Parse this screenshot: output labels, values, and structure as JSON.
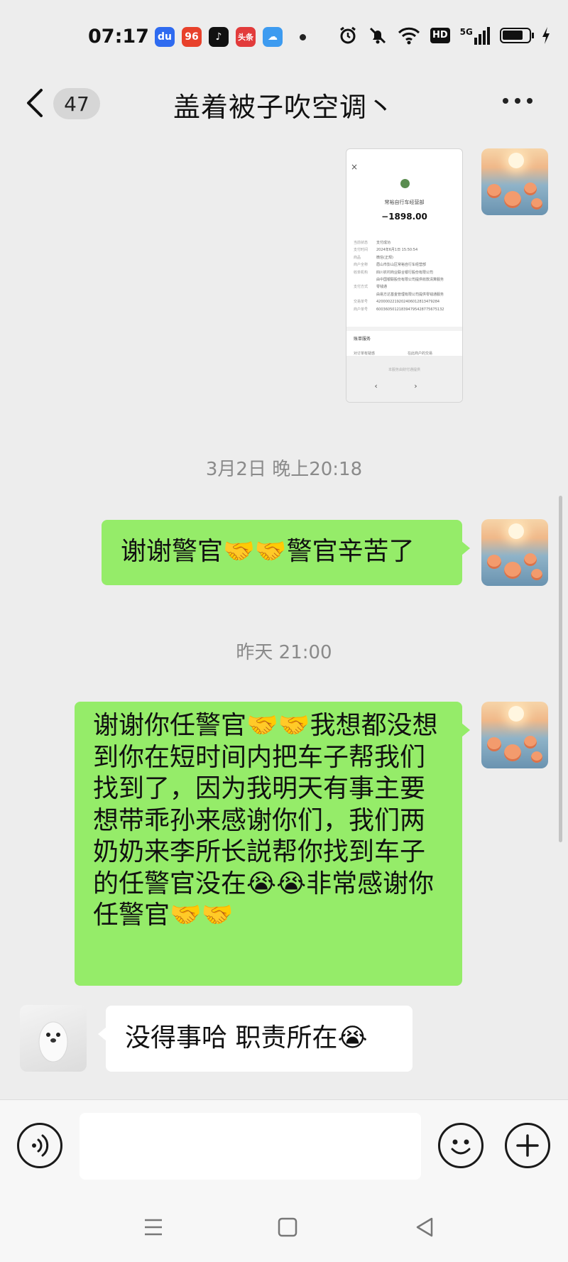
{
  "status_bar": {
    "time": "07:17",
    "apps": [
      {
        "icon": "baidu-icon",
        "label": "du",
        "color": "#2f6bf0"
      },
      {
        "icon": "app-icon",
        "label": "96",
        "color": "#e8412b"
      },
      {
        "icon": "tiktok-icon",
        "label": "♪",
        "color": "#111111"
      },
      {
        "icon": "toutiao-icon",
        "label": "头条",
        "color": "#e23b3b"
      },
      {
        "icon": "weather-icon",
        "label": "☁",
        "color": "#3d9bf0"
      }
    ],
    "indicators": [
      "alarm-icon",
      "mute-icon",
      "wifi-icon",
      "hd-icon",
      "5g-signal-icon",
      "battery-icon",
      "charging-icon"
    ],
    "hd_label": "HD",
    "network_label": "5G"
  },
  "header": {
    "unread_count": "47",
    "title": "盖着被子吹空调丶"
  },
  "messages": {
    "image": {
      "close": "×",
      "shop": "常裕自行车经营部",
      "amount": "−1898.00",
      "rows": [
        {
          "k": "当前状态",
          "v": "支付成功"
        },
        {
          "k": "支付时间",
          "v": "2024年6月1日 15:50:54"
        },
        {
          "k": "商品",
          "v": "微信(正规)"
        },
        {
          "k": "商户全称",
          "v": "眉山市彭山区常裕自行车经营部"
        },
        {
          "k": "收单机构",
          "v": "四川农村商业联合银行股份有限公司"
        },
        {
          "k": "",
          "v": "由中国银联股份有限公司提供收款清算服务"
        },
        {
          "k": "支付方式",
          "v": "零钱通"
        },
        {
          "k": "",
          "v": "由易方达基金管理有限公司提供零钱通服务"
        },
        {
          "k": "交易单号",
          "v": "4200002219202406012813479284"
        },
        {
          "k": "商户单号",
          "v": "600360501218394795428775675132"
        }
      ],
      "section_title": "账单服务",
      "action_left": "对订单有疑惑",
      "action_right": "在此商户的交易",
      "bottom_hint": "本服务由财付通提供",
      "nav": "‹ ›"
    },
    "ts1": "3月2日 晚上20:18",
    "msg1": "谢谢警官🤝🤝警官辛苦了",
    "ts2": "昨天 21:00",
    "msg2": "谢谢你任警官🤝🤝我想都没想到你在短时间内把车子帮我们找到了，因为我明天有事主要想带乖孙来感谢你们，我们两奶奶来李所长説帮你找到车子的任警官没在😭😭非常感谢你任警官🤝🤝",
    "msg3": "没得事哈 职责所在😭"
  },
  "input_bar": {
    "value": ""
  },
  "colors": {
    "self_bubble": "#95ec69",
    "other_bubble": "#ffffff",
    "background": "#ededed"
  }
}
